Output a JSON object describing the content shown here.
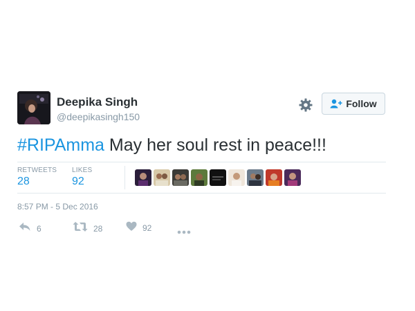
{
  "tweet": {
    "author": {
      "name": "Deepika Singh",
      "handle": "@deepikasingh150"
    },
    "follow_label": "Follow",
    "text": {
      "hashtag": "#RIPAmma",
      "body": " May her soul rest in peace!!!"
    },
    "stats": {
      "retweets_label": "RETWEETS",
      "retweets": "28",
      "likes_label": "LIKES",
      "likes": "92"
    },
    "liked_by_count_shown": 9,
    "timestamp": "8:57 PM - 5 Dec 2016",
    "actions": {
      "reply_count": "6",
      "retweet_count": "28",
      "like_count": "92"
    }
  },
  "colors": {
    "link": "#1b95e0",
    "muted": "#8899a6",
    "text": "#292f33",
    "border": "#e1e8ed"
  },
  "icons": [
    "gear-icon",
    "follow-person-icon",
    "reply-icon",
    "retweet-icon",
    "heart-icon",
    "more-icon"
  ]
}
